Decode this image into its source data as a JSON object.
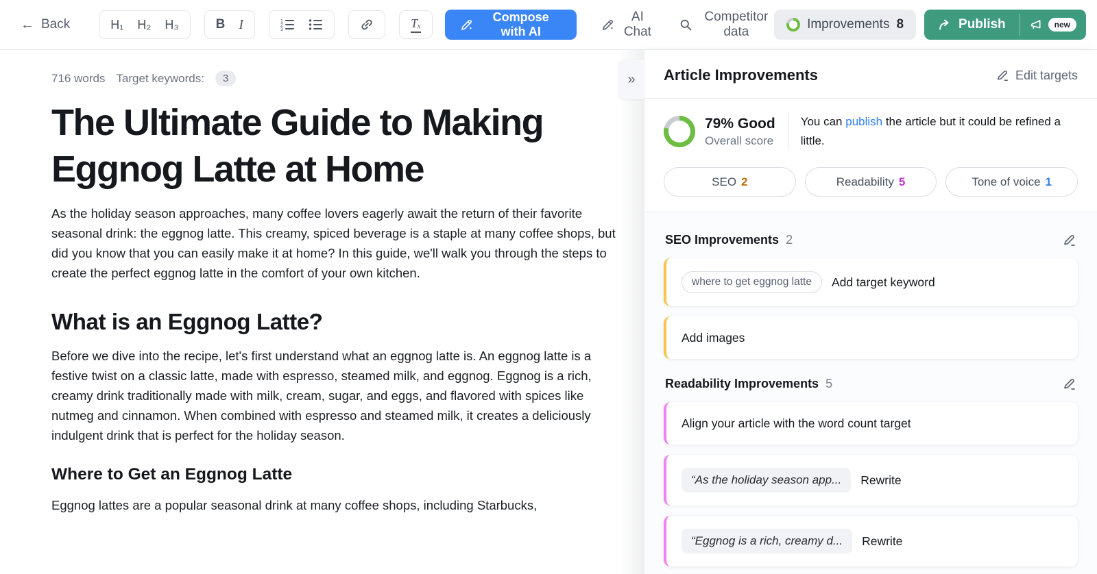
{
  "toolbar": {
    "back_label": "Back",
    "h1": "H₁",
    "h2": "H₂",
    "h3": "H₃",
    "bold": "B",
    "italic": "I",
    "clear_format": "Tₓ",
    "compose_label": "Compose with AI",
    "ai_chat_label": "AI Chat",
    "competitor_label": "Competitor data",
    "improvements_label": "Improvements",
    "improvements_count": "8",
    "publish_label": "Publish",
    "new_badge": "new"
  },
  "icons": {
    "back_arrow": "←",
    "collapse": "»"
  },
  "editor": {
    "word_count": "716 words",
    "target_keywords_label": "Target keywords:",
    "target_keywords_count": "3",
    "title": "The Ultimate Guide to Making Eggnog Latte at Home",
    "p1": "As the holiday season approaches, many coffee lovers eagerly await the return of their favorite seasonal drink: the eggnog latte. This creamy, spiced beverage is a staple at many coffee shops, but did you know that you can easily make it at home? In this guide, we'll walk you through the steps to create the perfect eggnog latte in the comfort of your own kitchen.",
    "h2": "What is an Eggnog Latte?",
    "p2": "Before we dive into the recipe, let's first understand what an eggnog latte is. An eggnog latte is a festive twist on a classic latte, made with espresso, steamed milk, and eggnog. Eggnog is a rich, creamy drink traditionally made with milk, cream, sugar, and eggs, and flavored with spices like nutmeg and cinnamon. When combined with espresso and steamed milk, it creates a deliciously indulgent drink that is perfect for the holiday season.",
    "h3": "Where to Get an Eggnog Latte",
    "p3": "Eggnog lattes are a popular seasonal drink at many coffee shops, including Starbucks,"
  },
  "sidebar": {
    "title": "Article Improvements",
    "edit_targets_label": "Edit targets",
    "score": {
      "percent": 79,
      "value": "79% Good",
      "label": "Overall score",
      "message_pre": "You can ",
      "message_link": "publish",
      "message_post": " the article but it could be refined a little."
    },
    "pills": [
      {
        "label": "SEO",
        "count": "2"
      },
      {
        "label": "Readability",
        "count": "5"
      },
      {
        "label": "Tone of voice",
        "count": "1"
      }
    ],
    "seo": {
      "title": "SEO Improvements",
      "count": "2",
      "cards": [
        {
          "chip": "where to get eggnog latte",
          "text": "Add target keyword"
        },
        {
          "text": "Add images"
        }
      ]
    },
    "readability": {
      "title": "Readability Improvements",
      "count": "5",
      "cards": [
        {
          "text": "Align your article with the word count target"
        },
        {
          "quote": "“As the holiday season app...",
          "action": "Rewrite"
        },
        {
          "quote": "“Eggnog is a rich, creamy d...",
          "action": "Rewrite"
        }
      ]
    }
  },
  "colors": {
    "accent-blue": "#3b86f7",
    "publish-green": "#3f9b7d",
    "badge-bg": "#ecedf0",
    "link-blue": "#2e7ff1",
    "ring-green": "#6cbd41",
    "ring-track": "#c9cdd3",
    "seo-count": "#c06e0e",
    "readability-count": "#bf33cf",
    "tone-count": "#2f80ed",
    "seo-accent": "#f6c44f",
    "readability-accent": "#f083f0"
  }
}
